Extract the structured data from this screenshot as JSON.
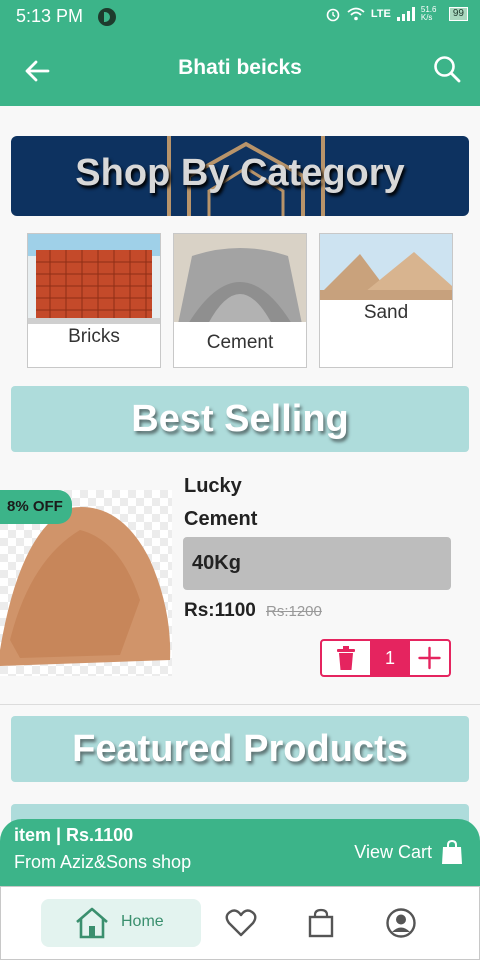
{
  "status_bar": {
    "time": "5:13 PM",
    "network": "LTE",
    "speed": "51.6 K/s",
    "battery": "99"
  },
  "app_bar": {
    "title": "Bhati beicks",
    "back_icon": "arrow-left-icon",
    "search_icon": "search-icon"
  },
  "banner": {
    "title": "Shop By Category"
  },
  "categories": [
    {
      "label": "Bricks"
    },
    {
      "label": "Cement"
    },
    {
      "label": "Sand"
    }
  ],
  "sections": {
    "best_selling": "Best Selling",
    "featured": "Featured Products"
  },
  "product": {
    "discount": "8% OFF",
    "name": "Lucky Cement",
    "weight": "40Kg",
    "price": "Rs:1100",
    "old_price": "Rs:1200",
    "quantity": "1"
  },
  "cart_bar": {
    "summary": "item | Rs.1100",
    "shop": "From Aziz&Sons shop",
    "action": "View Cart"
  },
  "bottom_nav": {
    "home": "Home",
    "active": "home"
  },
  "colors": {
    "primary": "#3cb489",
    "banner": "#0d3260",
    "section": "#aedcdb",
    "accent": "#e5245f"
  }
}
